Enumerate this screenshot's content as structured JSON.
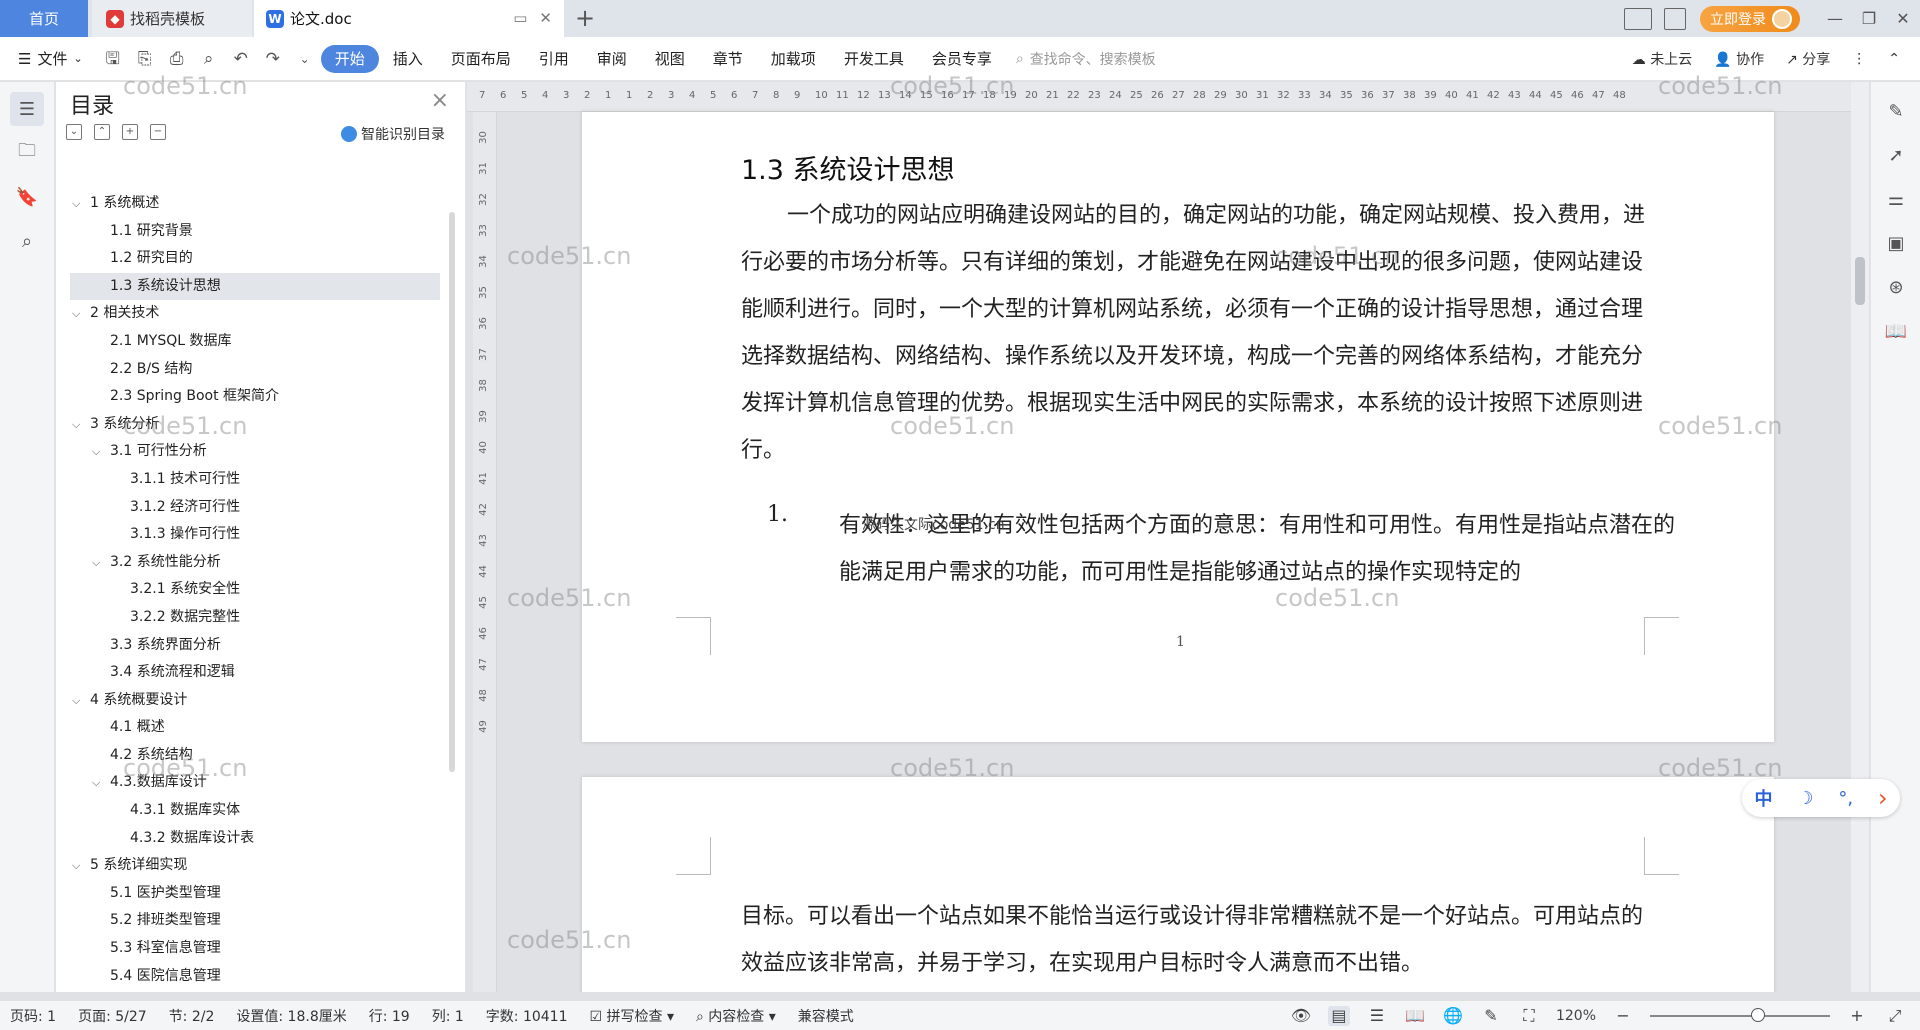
{
  "titlebar": {
    "tabs": [
      {
        "label": "首页"
      },
      {
        "label": "找稻壳模板"
      },
      {
        "label": "论文.doc"
      }
    ],
    "login_label": "立即登录"
  },
  "ribbon": {
    "file_label": "文件",
    "tabs": [
      "开始",
      "插入",
      "页面布局",
      "引用",
      "审阅",
      "视图",
      "章节",
      "加载项",
      "开发工具",
      "会员专享"
    ],
    "search_placeholder": "查找命令、搜索模板",
    "right": [
      "未上云",
      "协作",
      "分享"
    ]
  },
  "toc": {
    "title": "目录",
    "smart_label": "智能识别目录",
    "items": [
      {
        "label": "1 系统概述",
        "level": 1,
        "expanded": true
      },
      {
        "label": "1.1  研究背景",
        "level": 2
      },
      {
        "label": "1.2 研究目的",
        "level": 2
      },
      {
        "label": "1.3 系统设计思想",
        "level": 2,
        "selected": true
      },
      {
        "label": "2 相关技术",
        "level": 1,
        "expanded": true
      },
      {
        "label": "2.1 MYSQL 数据库",
        "level": 2
      },
      {
        "label": "2.2 B/S 结构",
        "level": 2
      },
      {
        "label": "2.3 Spring Boot 框架简介",
        "level": 2
      },
      {
        "label": "3 系统分析",
        "level": 1,
        "expanded": true
      },
      {
        "label": "3.1 可行性分析",
        "level": 2,
        "expanded": true
      },
      {
        "label": "3.1.1 技术可行性",
        "level": 3
      },
      {
        "label": "3.1.2 经济可行性",
        "level": 3
      },
      {
        "label": "3.1.3 操作可行性",
        "level": 3
      },
      {
        "label": "3.2 系统性能分析",
        "level": 2,
        "expanded": true
      },
      {
        "label": "3.2.1  系统安全性",
        "level": 3
      },
      {
        "label": "3.2.2  数据完整性",
        "level": 3
      },
      {
        "label": "3.3 系统界面分析",
        "level": 2
      },
      {
        "label": "3.4 系统流程和逻辑",
        "level": 2
      },
      {
        "label": "4 系统概要设计",
        "level": 1,
        "expanded": true
      },
      {
        "label": "4.1 概述",
        "level": 2
      },
      {
        "label": "4.2 系统结构",
        "level": 2
      },
      {
        "label": "4.3.数据库设计",
        "level": 2,
        "expanded": true
      },
      {
        "label": "4.3.1 数据库实体",
        "level": 3
      },
      {
        "label": "4.3.2 数据库设计表",
        "level": 3
      },
      {
        "label": "5 系统详细实现",
        "level": 1,
        "expanded": true
      },
      {
        "label": "5.1  医护类型管理",
        "level": 2
      },
      {
        "label": "5.2  排班类型管理",
        "level": 2
      },
      {
        "label": "5.3  科室信息管理",
        "level": 2
      },
      {
        "label": "5.4  医院信息管理",
        "level": 2
      }
    ]
  },
  "ruler": {
    "h_ticks": [
      "7",
      "6",
      "5",
      "4",
      "3",
      "2",
      "1",
      "1",
      "2",
      "3",
      "4",
      "5",
      "6",
      "7",
      "8",
      "9",
      "10",
      "11",
      "12",
      "13",
      "14",
      "15",
      "16",
      "17",
      "18",
      "19",
      "20",
      "21",
      "22",
      "23",
      "24",
      "25",
      "26",
      "27",
      "28",
      "29",
      "30",
      "31",
      "32",
      "33",
      "34",
      "35",
      "36",
      "37",
      "38",
      "39",
      "40",
      "41",
      "42",
      "43",
      "44",
      "45",
      "46",
      "47",
      "48"
    ],
    "v_ticks": [
      "30",
      "31",
      "32",
      "33",
      "34",
      "35",
      "36",
      "37",
      "38",
      "39",
      "40",
      "41",
      "42",
      "43",
      "44",
      "45",
      "46",
      "47",
      "48",
      "49"
    ]
  },
  "document": {
    "heading": "1.3 系统设计思想",
    "para1": "一个成功的网站应明确建设网站的目的，确定网站的功能，确定网站规模、投入费用，进行必要的市场分析等。只有详细的策划，才能避免在网站建设中出现的很多问题，使网站建设能顺利进行。同时，一个大型的计算机网站系统，必须有一个正确的设计指导思想，通过合理选择数据结构、网络结构、操作系统以及开发环境，构成一个完善的网络体系结构，才能充分发挥计算机信息管理的优势。根据现实生活中网民的实际需求，本系统的设计按照下述原则进行。",
    "list_num": "1.",
    "list_text": "有效性：这里的有效性包括两个方面的意思：有用性和可用性。有用性是指站点潜在的能满足用户需求的功能，而可用性是指能够通过站点的操作实现特定的",
    "overlay_text": "源码久文际code51.cn",
    "page_number": "1",
    "page2_text": "目标。可以看出一个站点如果不能恰当运行或设计得非常糟糕就不是一个好站点。可用站点的效益应该非常高，并易于学习，在实现用户目标时令人满意而不出错。"
  },
  "watermark": "code51.cn",
  "ime": {
    "items": [
      "中",
      "☽",
      "°,",
      "›"
    ]
  },
  "status": {
    "page_code": "页码: 1",
    "page": "页面: 5/27",
    "section": "节: 2/2",
    "setting": "设置值: 18.8厘米",
    "row": "行: 19",
    "col": "列: 1",
    "words": "字数: 10411",
    "spell": "拼写检查",
    "content": "内容检查",
    "compat": "兼容模式",
    "zoom": "120%",
    "zoom_fraction": 0.6
  }
}
